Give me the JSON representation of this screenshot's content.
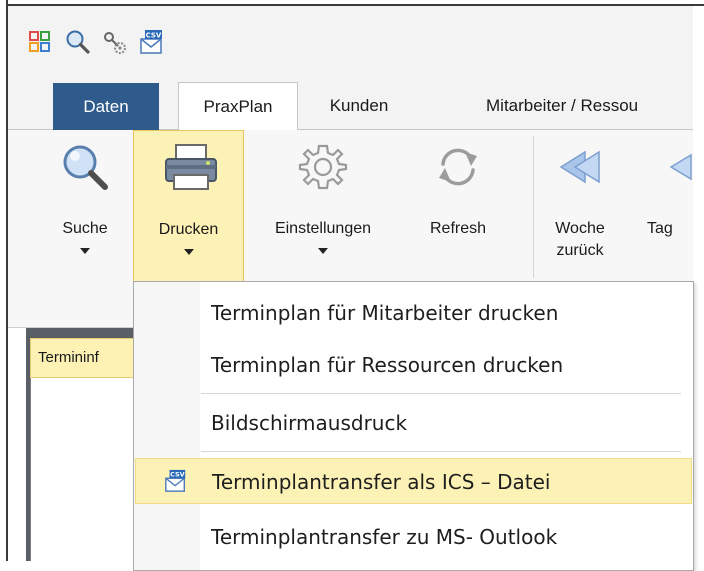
{
  "colors": {
    "file_tab": "#2e5a8c",
    "highlight": "#fcf2b6",
    "highlight_border": "#e6c75f"
  },
  "quick_access": [
    {
      "icon": "grid-icon"
    },
    {
      "icon": "search-icon"
    },
    {
      "icon": "key-gear-icon"
    },
    {
      "icon": "csv-mail-icon"
    }
  ],
  "tabs": [
    {
      "label": "Daten",
      "kind": "file"
    },
    {
      "label": "PraxPlan",
      "kind": "active"
    },
    {
      "label": "Kunden",
      "kind": "normal"
    },
    {
      "label": "Mitarbeiter / Ressou",
      "kind": "normal"
    }
  ],
  "ribbon": {
    "buttons": [
      {
        "label": "Suche",
        "icon": "magnifier-icon",
        "has_dropdown": true
      },
      {
        "label": "Drucken",
        "icon": "printer-icon",
        "has_dropdown": true,
        "selected": true
      },
      {
        "label": "Einstellungen",
        "icon": "gear-icon",
        "has_dropdown": true
      },
      {
        "label": "Refresh",
        "icon": "refresh-icon",
        "has_dropdown": false
      },
      {
        "label": "Woche zurück",
        "line1": "Woche",
        "line2": "zurück",
        "icon": "double-arrow-left-icon",
        "has_dropdown": false
      },
      {
        "label": "Tag",
        "icon": "arrow-left-icon",
        "has_dropdown": false
      }
    ]
  },
  "left_panel": {
    "tab_label": "Termininf"
  },
  "menu": {
    "items": [
      {
        "label": "Terminplan für Mitarbeiter drucken"
      },
      {
        "label": "Terminplan für Ressourcen drucken"
      },
      {
        "label": "Bildschirmausdruck"
      },
      {
        "label": "Terminplantransfer als ICS – Datei",
        "icon": "csv-mail-icon",
        "hovered": true
      },
      {
        "label": "Terminplantransfer zu MS- Outlook"
      }
    ]
  }
}
